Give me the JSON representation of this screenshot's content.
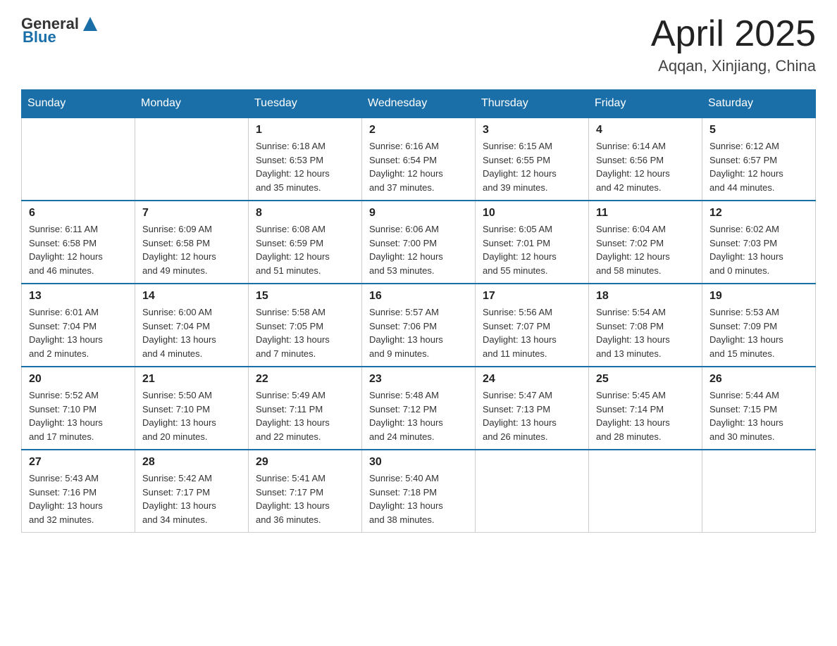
{
  "header": {
    "logo_general": "General",
    "logo_blue": "Blue",
    "title": "April 2025",
    "location": "Aqqan, Xinjiang, China"
  },
  "weekdays": [
    "Sunday",
    "Monday",
    "Tuesday",
    "Wednesday",
    "Thursday",
    "Friday",
    "Saturday"
  ],
  "weeks": [
    [
      {
        "day": "",
        "info": ""
      },
      {
        "day": "",
        "info": ""
      },
      {
        "day": "1",
        "info": "Sunrise: 6:18 AM\nSunset: 6:53 PM\nDaylight: 12 hours\nand 35 minutes."
      },
      {
        "day": "2",
        "info": "Sunrise: 6:16 AM\nSunset: 6:54 PM\nDaylight: 12 hours\nand 37 minutes."
      },
      {
        "day": "3",
        "info": "Sunrise: 6:15 AM\nSunset: 6:55 PM\nDaylight: 12 hours\nand 39 minutes."
      },
      {
        "day": "4",
        "info": "Sunrise: 6:14 AM\nSunset: 6:56 PM\nDaylight: 12 hours\nand 42 minutes."
      },
      {
        "day": "5",
        "info": "Sunrise: 6:12 AM\nSunset: 6:57 PM\nDaylight: 12 hours\nand 44 minutes."
      }
    ],
    [
      {
        "day": "6",
        "info": "Sunrise: 6:11 AM\nSunset: 6:58 PM\nDaylight: 12 hours\nand 46 minutes."
      },
      {
        "day": "7",
        "info": "Sunrise: 6:09 AM\nSunset: 6:58 PM\nDaylight: 12 hours\nand 49 minutes."
      },
      {
        "day": "8",
        "info": "Sunrise: 6:08 AM\nSunset: 6:59 PM\nDaylight: 12 hours\nand 51 minutes."
      },
      {
        "day": "9",
        "info": "Sunrise: 6:06 AM\nSunset: 7:00 PM\nDaylight: 12 hours\nand 53 minutes."
      },
      {
        "day": "10",
        "info": "Sunrise: 6:05 AM\nSunset: 7:01 PM\nDaylight: 12 hours\nand 55 minutes."
      },
      {
        "day": "11",
        "info": "Sunrise: 6:04 AM\nSunset: 7:02 PM\nDaylight: 12 hours\nand 58 minutes."
      },
      {
        "day": "12",
        "info": "Sunrise: 6:02 AM\nSunset: 7:03 PM\nDaylight: 13 hours\nand 0 minutes."
      }
    ],
    [
      {
        "day": "13",
        "info": "Sunrise: 6:01 AM\nSunset: 7:04 PM\nDaylight: 13 hours\nand 2 minutes."
      },
      {
        "day": "14",
        "info": "Sunrise: 6:00 AM\nSunset: 7:04 PM\nDaylight: 13 hours\nand 4 minutes."
      },
      {
        "day": "15",
        "info": "Sunrise: 5:58 AM\nSunset: 7:05 PM\nDaylight: 13 hours\nand 7 minutes."
      },
      {
        "day": "16",
        "info": "Sunrise: 5:57 AM\nSunset: 7:06 PM\nDaylight: 13 hours\nand 9 minutes."
      },
      {
        "day": "17",
        "info": "Sunrise: 5:56 AM\nSunset: 7:07 PM\nDaylight: 13 hours\nand 11 minutes."
      },
      {
        "day": "18",
        "info": "Sunrise: 5:54 AM\nSunset: 7:08 PM\nDaylight: 13 hours\nand 13 minutes."
      },
      {
        "day": "19",
        "info": "Sunrise: 5:53 AM\nSunset: 7:09 PM\nDaylight: 13 hours\nand 15 minutes."
      }
    ],
    [
      {
        "day": "20",
        "info": "Sunrise: 5:52 AM\nSunset: 7:10 PM\nDaylight: 13 hours\nand 17 minutes."
      },
      {
        "day": "21",
        "info": "Sunrise: 5:50 AM\nSunset: 7:10 PM\nDaylight: 13 hours\nand 20 minutes."
      },
      {
        "day": "22",
        "info": "Sunrise: 5:49 AM\nSunset: 7:11 PM\nDaylight: 13 hours\nand 22 minutes."
      },
      {
        "day": "23",
        "info": "Sunrise: 5:48 AM\nSunset: 7:12 PM\nDaylight: 13 hours\nand 24 minutes."
      },
      {
        "day": "24",
        "info": "Sunrise: 5:47 AM\nSunset: 7:13 PM\nDaylight: 13 hours\nand 26 minutes."
      },
      {
        "day": "25",
        "info": "Sunrise: 5:45 AM\nSunset: 7:14 PM\nDaylight: 13 hours\nand 28 minutes."
      },
      {
        "day": "26",
        "info": "Sunrise: 5:44 AM\nSunset: 7:15 PM\nDaylight: 13 hours\nand 30 minutes."
      }
    ],
    [
      {
        "day": "27",
        "info": "Sunrise: 5:43 AM\nSunset: 7:16 PM\nDaylight: 13 hours\nand 32 minutes."
      },
      {
        "day": "28",
        "info": "Sunrise: 5:42 AM\nSunset: 7:17 PM\nDaylight: 13 hours\nand 34 minutes."
      },
      {
        "day": "29",
        "info": "Sunrise: 5:41 AM\nSunset: 7:17 PM\nDaylight: 13 hours\nand 36 minutes."
      },
      {
        "day": "30",
        "info": "Sunrise: 5:40 AM\nSunset: 7:18 PM\nDaylight: 13 hours\nand 38 minutes."
      },
      {
        "day": "",
        "info": ""
      },
      {
        "day": "",
        "info": ""
      },
      {
        "day": "",
        "info": ""
      }
    ]
  ]
}
